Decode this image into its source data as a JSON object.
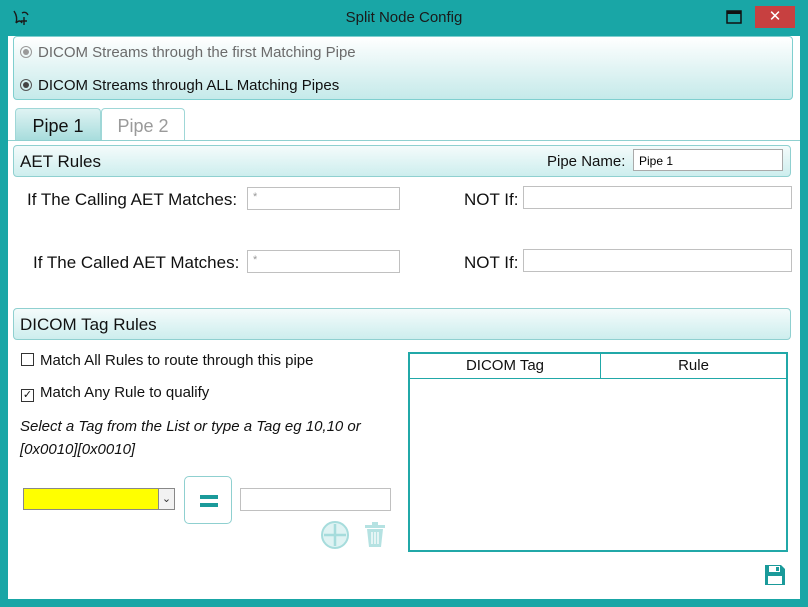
{
  "window": {
    "title": "Split Node Config",
    "close_glyph": "✕"
  },
  "routing": {
    "option_first": "DICOM Streams through the first Matching Pipe",
    "option_all": "DICOM Streams through ALL Matching Pipes",
    "selected": "all"
  },
  "tabs": [
    {
      "label": "Pipe 1",
      "active": true
    },
    {
      "label": "Pipe 2",
      "active": false
    }
  ],
  "aet_rules": {
    "title": "AET Rules",
    "pipe_name_label": "Pipe Name:",
    "pipe_name_value": "Pipe 1",
    "calling_label": "If The Calling AET Matches:",
    "calling_value": "*",
    "called_label": "If The Called AET Matches:",
    "called_value": "*",
    "not_if_label": "NOT If:"
  },
  "tag_rules": {
    "title": "DICOM Tag Rules",
    "match_all_label": "Match All Rules to route through this pipe",
    "match_all_checked": false,
    "match_any_label": "Match Any Rule to qualify",
    "match_any_checked": true,
    "hint": "Select a Tag from the List or type a Tag eg 10,10 or [0x0010][0x0010]",
    "combo_arrow": "⌄",
    "columns": [
      "DICOM Tag",
      "Rule"
    ],
    "rows": []
  },
  "icons": {
    "app": "app-logo-icon",
    "maximize": "maximize-icon",
    "close": "close-icon",
    "equals": "equals-icon",
    "add": "add-circle-icon",
    "delete": "trash-icon",
    "save": "save-icon"
  },
  "colors": {
    "frame": "#19a6a6",
    "accent": "#1a9a9a",
    "close_button": "#c74040",
    "combo_highlight": "#ffff00"
  }
}
